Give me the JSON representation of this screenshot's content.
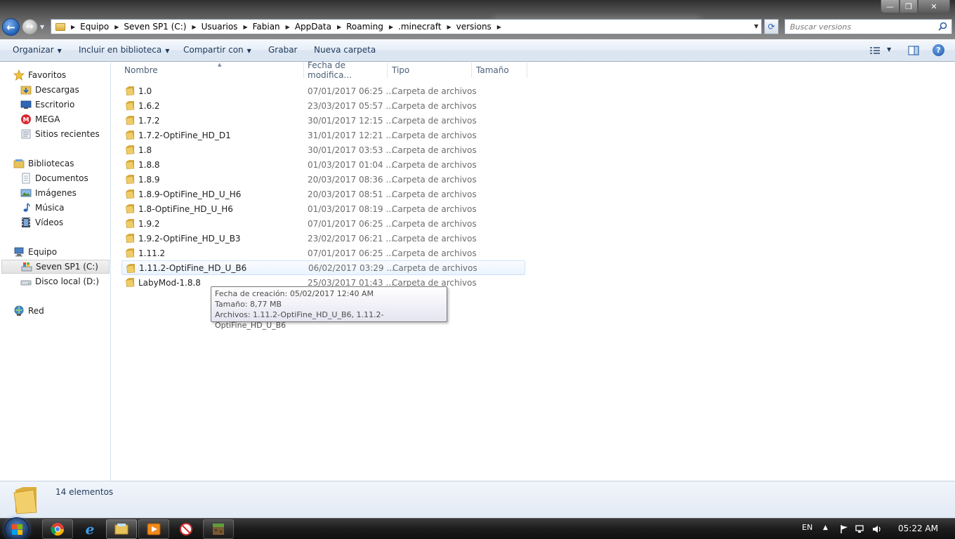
{
  "window": {
    "controls": {
      "minimize": "—",
      "maximize": "❐",
      "close": "✕"
    }
  },
  "address": {
    "crumbs": [
      "Equipo",
      "Seven SP1 (C:)",
      "Usuarios",
      "Fabian",
      "AppData",
      "Roaming",
      ".minecraft",
      "versions"
    ]
  },
  "search": {
    "placeholder": "Buscar versions"
  },
  "toolbar": {
    "organize": "Organizar",
    "include_library": "Incluir en biblioteca",
    "share_with": "Compartir con",
    "burn": "Grabar",
    "new_folder": "Nueva carpeta",
    "help": "?"
  },
  "nav": {
    "favorites": "Favoritos",
    "downloads": "Descargas",
    "desktop": "Escritorio",
    "mega": "MEGA",
    "recent": "Sitios recientes",
    "libraries": "Bibliotecas",
    "documents": "Documentos",
    "pictures": "Imágenes",
    "music": "Música",
    "videos": "Vídeos",
    "computer": "Equipo",
    "drive_c": "Seven SP1 (C:)",
    "drive_d": "Disco local (D:)",
    "network": "Red"
  },
  "columns": {
    "name": "Nombre",
    "date": "Fecha de modifica...",
    "type": "Tipo",
    "size": "Tamaño"
  },
  "files": [
    {
      "name": "1.0",
      "date": "07/01/2017 06:25 ...",
      "type": "Carpeta de archivos"
    },
    {
      "name": "1.6.2",
      "date": "23/03/2017 05:57 ...",
      "type": "Carpeta de archivos"
    },
    {
      "name": "1.7.2",
      "date": "30/01/2017 12:15 ...",
      "type": "Carpeta de archivos"
    },
    {
      "name": "1.7.2-OptiFine_HD_D1",
      "date": "31/01/2017 12:21 ...",
      "type": "Carpeta de archivos"
    },
    {
      "name": "1.8",
      "date": "30/01/2017 03:53 ...",
      "type": "Carpeta de archivos"
    },
    {
      "name": "1.8.8",
      "date": "01/03/2017 01:04 ...",
      "type": "Carpeta de archivos"
    },
    {
      "name": "1.8.9",
      "date": "20/03/2017 08:36 ...",
      "type": "Carpeta de archivos"
    },
    {
      "name": "1.8.9-OptiFine_HD_U_H6",
      "date": "20/03/2017 08:51 ...",
      "type": "Carpeta de archivos"
    },
    {
      "name": "1.8-OptiFine_HD_U_H6",
      "date": "01/03/2017 08:19 ...",
      "type": "Carpeta de archivos"
    },
    {
      "name": "1.9.2",
      "date": "07/01/2017 06:25 ...",
      "type": "Carpeta de archivos"
    },
    {
      "name": "1.9.2-OptiFine_HD_U_B3",
      "date": "23/02/2017 06:21 ...",
      "type": "Carpeta de archivos"
    },
    {
      "name": "1.11.2",
      "date": "07/01/2017 06:25 ...",
      "type": "Carpeta de archivos"
    },
    {
      "name": "1.11.2-OptiFine_HD_U_B6",
      "date": "06/02/2017 03:29 ...",
      "type": "Carpeta de archivos"
    },
    {
      "name": "LabyMod-1.8.8",
      "date": "25/03/2017 01:43 ...",
      "type": "Carpeta de archivos"
    }
  ],
  "tooltip": {
    "created": "Fecha de creación: 05/02/2017 12:40 AM",
    "size": "Tamaño: 8,77 MB",
    "files": "Archivos: 1.11.2-OptiFine_HD_U_B6, 1.11.2-OptiFine_HD_U_B6"
  },
  "details": {
    "count": "14 elementos"
  },
  "taskbar": {
    "language": "EN",
    "time": "05:22 AM"
  },
  "colors": {
    "accent": "#1e395b",
    "selection": "#eaf3fd",
    "folder": "#e8c25a"
  }
}
